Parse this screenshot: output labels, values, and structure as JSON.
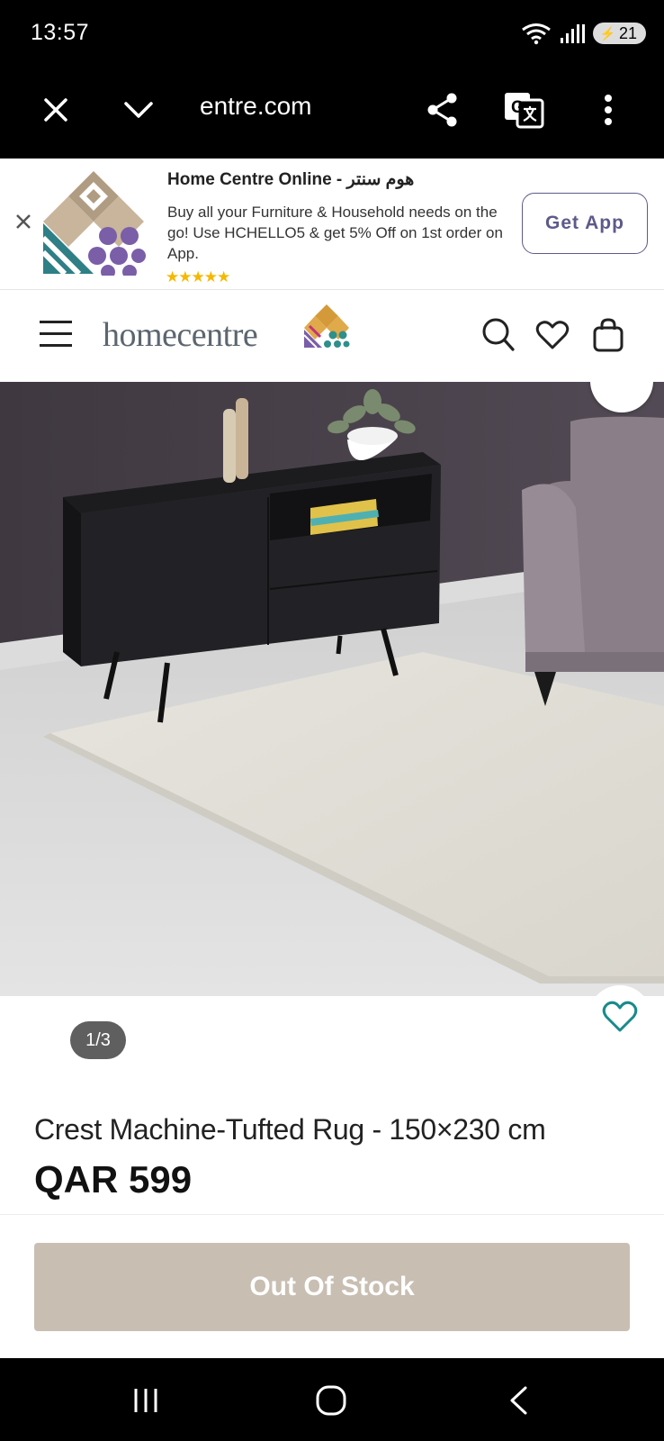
{
  "status": {
    "time": "13:57",
    "battery": "21"
  },
  "browser": {
    "url": "entre.com"
  },
  "banner": {
    "title": "Home Centre Online - هوم سنتر",
    "description": "Buy all your Furniture & Household needs on the go! Use HCHELLO5 & get 5% Off on 1st order on App.",
    "stars": "★★★★★",
    "cta": "Get App"
  },
  "header": {
    "brand": "homecentre"
  },
  "gallery": {
    "counter": "1/3"
  },
  "product": {
    "title": "Crest Machine-Tufted Rug - 150×230 cm",
    "price": "QAR 599",
    "stock_button": "Out Of Stock"
  },
  "colors": {
    "accent": "#5d5a8a",
    "teal": "#1a8a8a",
    "oos": "#c8beb2"
  }
}
